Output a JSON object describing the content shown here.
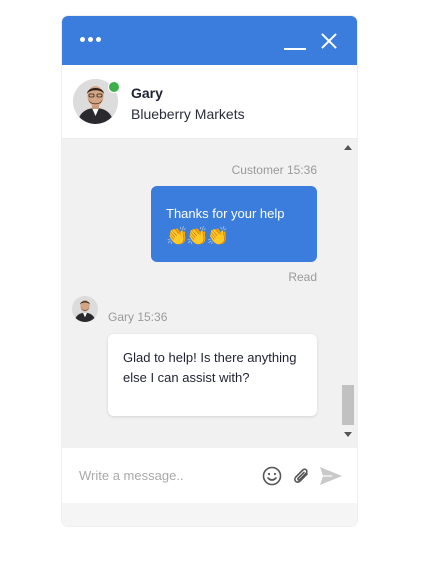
{
  "header": {
    "menu_icon": "more-dots-icon",
    "minimize_icon": "minimize-icon",
    "close_icon": "close-icon",
    "accent_color": "#3b7ddd"
  },
  "agent": {
    "name": "Gary",
    "company": "Blueberry Markets",
    "status_color": "#3cae4a"
  },
  "messages": {
    "customer_meta": "Customer 15:36",
    "customer_text": "Thanks for your help",
    "customer_emoji": "👏👏👏",
    "read_status": "Read",
    "agent_meta": "Gary 15:36",
    "agent_text": "Glad to help! Is there anything else I can assist with?"
  },
  "composer": {
    "placeholder": "Write a message..",
    "emoji_icon": "smiley-icon",
    "attach_icon": "paperclip-icon",
    "send_icon": "send-icon"
  }
}
